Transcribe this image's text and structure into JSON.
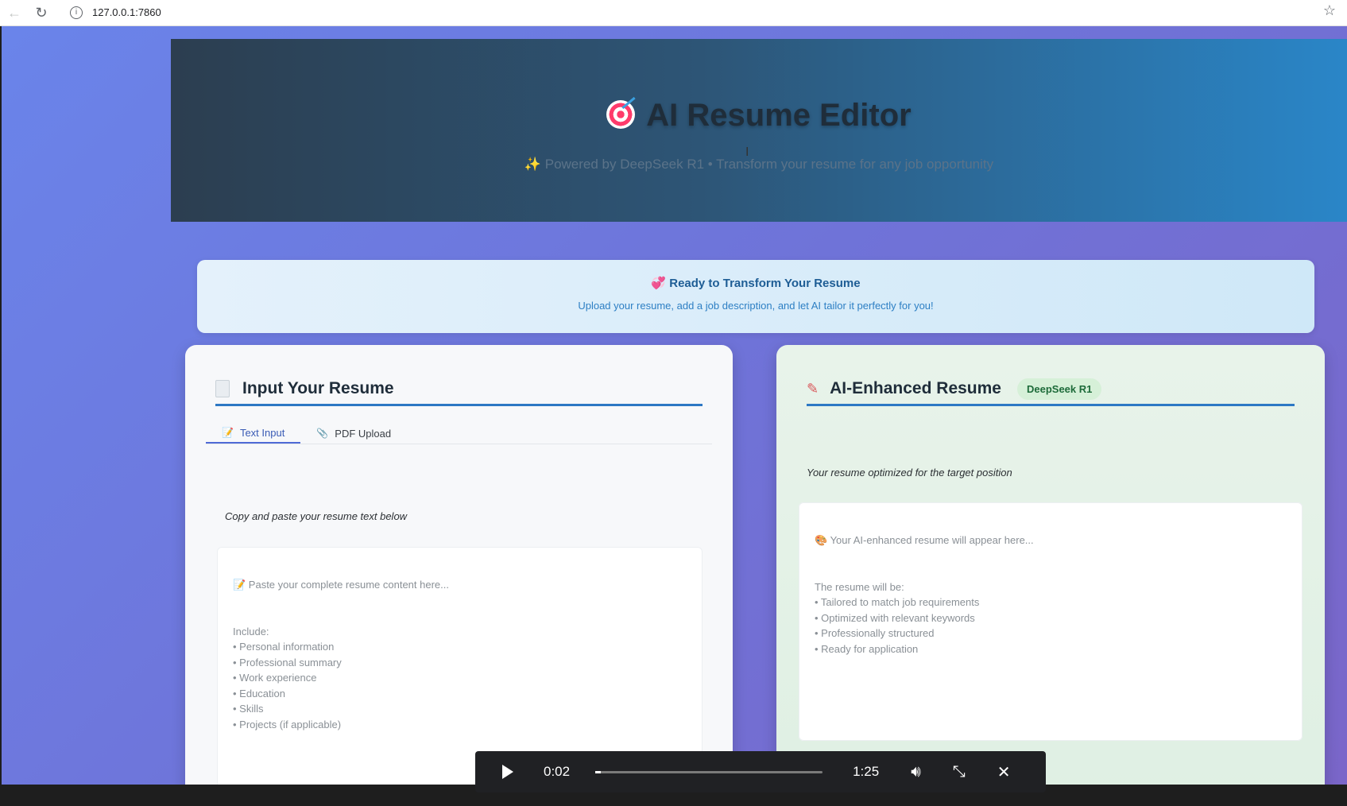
{
  "browser": {
    "url": "127.0.0.1:7860",
    "back_icon": "back-arrow-icon",
    "reload_icon": "reload-icon",
    "star_icon": "star-icon"
  },
  "hero": {
    "title": "AI Resume Editor",
    "subtitle": "✨ Powered by DeepSeek R1 • Transform your resume for any job opportunity"
  },
  "banner": {
    "title": "💞 Ready to Transform Your Resume",
    "text": "Upload your resume, add a job description, and let AI tailor it perfectly for you!"
  },
  "input_card": {
    "title": "Input Your Resume",
    "tabs": [
      {
        "label": "Text Input",
        "icon": "📝",
        "active": true
      },
      {
        "label": "PDF Upload",
        "icon": "📎",
        "active": false
      }
    ],
    "hint": "Copy and paste your resume text below",
    "placeholder_first": "📝 Paste your complete resume content here...",
    "placeholder_body": "Include:\n• Personal information\n• Professional summary\n• Work experience\n• Education\n• Skills\n• Projects (if applicable)"
  },
  "output_card": {
    "title": "AI-Enhanced Resume",
    "badge": "DeepSeek R1",
    "hint": "Your resume optimized for the target position",
    "placeholder_first": "🎨 Your AI-enhanced resume will appear here...",
    "placeholder_body": "The resume will be:\n• Tailored to match job requirements\n• Optimized with relevant keywords\n• Professionally structured\n• Ready for application"
  },
  "video": {
    "current_time": "0:02",
    "duration": "1:25",
    "progress": 0.023
  },
  "colors": {
    "accent": "#2d78c4",
    "badge_bg": "#d6f0d8",
    "hero_start": "#2c3e50",
    "hero_end": "#2a86c8"
  }
}
